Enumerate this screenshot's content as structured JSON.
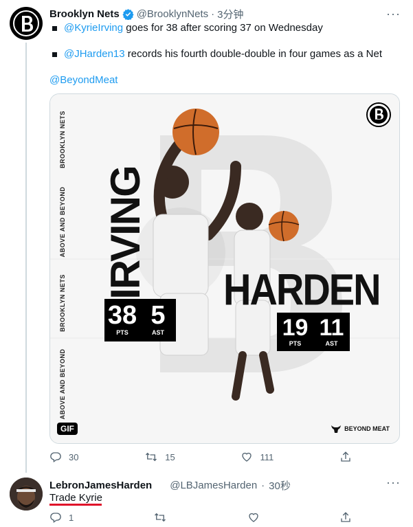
{
  "tweet": {
    "display_name": "Brooklyn Nets",
    "handle": "@BrooklynNets",
    "separator": "·",
    "time": "3分钟",
    "more": "···",
    "lines": [
      {
        "mention": "@KyrieIrving",
        "text": " goes for 38 after scoring 37 on Wednesday"
      },
      {
        "mention": "@JHarden13",
        "text": " records his fourth double-double in four games as a Net"
      }
    ],
    "sponsor_mention": "@BeyondMeat",
    "media": {
      "side_text": [
        "BROOKLYN NETS",
        "ABOVE AND BEYOND",
        "BROOKLYN NETS",
        "ABOVE AND BEYOND"
      ],
      "irving_name": "IRVING",
      "harden_name": "HARDEN",
      "irving_stats": [
        {
          "value": "38",
          "label": "PTS"
        },
        {
          "value": "5",
          "label": "AST"
        }
      ],
      "harden_stats": [
        {
          "value": "19",
          "label": "PTS"
        },
        {
          "value": "11",
          "label": "AST"
        }
      ],
      "gif_badge": "GIF",
      "sponsor_logo": "BEYOND MEAT"
    },
    "actions": {
      "replies": "30",
      "retweets": "15",
      "likes": "111"
    }
  },
  "reply": {
    "display_name": "LebronJamesHarden",
    "handle": "@LBJamesHarden",
    "separator": "·",
    "time": "30秒",
    "more": "···",
    "text": "Trade Kyrie",
    "actions": {
      "replies": "1"
    }
  },
  "colors": {
    "link": "#1d9bf0",
    "verified": "#1d9bf0",
    "muted": "#536471",
    "underline": "#e0102a"
  }
}
